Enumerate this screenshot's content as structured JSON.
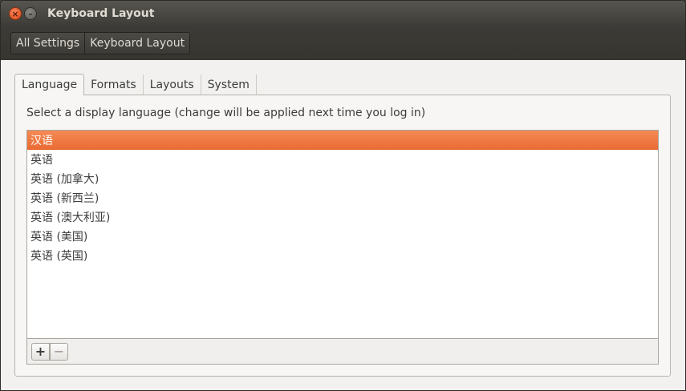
{
  "window": {
    "title": "Keyboard Layout",
    "close_glyph": "×",
    "minimize_glyph": "–"
  },
  "breadcrumb": {
    "items": [
      "All Settings",
      "Keyboard Layout"
    ]
  },
  "tabs": [
    {
      "label": "Language",
      "active": true
    },
    {
      "label": "Formats",
      "active": false
    },
    {
      "label": "Layouts",
      "active": false
    },
    {
      "label": "System",
      "active": false
    }
  ],
  "language_tab": {
    "instruction": "Select a display language (change will be applied next time you log in)",
    "languages": [
      {
        "label": "汉语",
        "selected": true
      },
      {
        "label": "英语",
        "selected": false
      },
      {
        "label": "英语 (加拿大)",
        "selected": false
      },
      {
        "label": "英语 (新西兰)",
        "selected": false
      },
      {
        "label": "英语 (澳大利亚)",
        "selected": false
      },
      {
        "label": "英语 (美国)",
        "selected": false
      },
      {
        "label": "英语 (英国)",
        "selected": false
      }
    ],
    "add_glyph": "+",
    "remove_glyph": "−"
  },
  "colors": {
    "selection": "#ef7a43",
    "titlebar": "#3c3b37",
    "close_button": "#e95420"
  },
  "icons": {
    "close": "close-icon",
    "minimize": "minimize-icon",
    "add": "plus-icon",
    "remove": "minus-icon"
  }
}
